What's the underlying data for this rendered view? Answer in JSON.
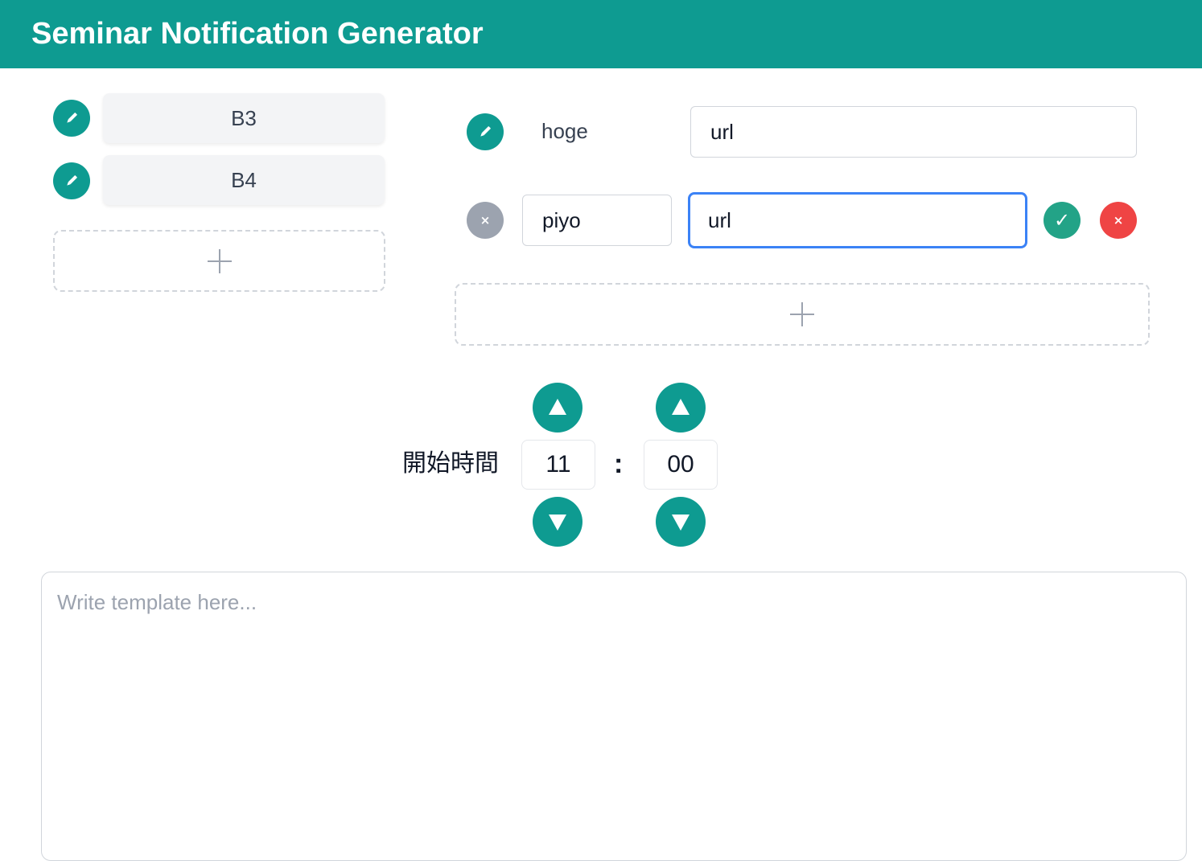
{
  "app": {
    "title": "Seminar Notification Generator",
    "accent_color": "#0e9b91"
  },
  "groups": {
    "items": [
      {
        "label": "B3",
        "icon": "pencil-icon"
      },
      {
        "label": "B4",
        "icon": "pencil-icon"
      }
    ],
    "add_icon": "plus-icon"
  },
  "links": {
    "rows": [
      {
        "name": "hoge",
        "url": "url",
        "mode": "view",
        "icon": "pencil-icon"
      },
      {
        "name": "piyo",
        "url": "url",
        "mode": "edit",
        "icon": "close-icon"
      }
    ],
    "confirm_icon": "check-icon",
    "cancel_icon": "close-icon",
    "confirm_glyph": "✓",
    "cancel_glyph": "×",
    "remove_glyph": "×",
    "add_icon": "plus-icon"
  },
  "start_time": {
    "label": "開始時間",
    "hour": "11",
    "minute": "00",
    "separator": ":"
  },
  "template": {
    "placeholder": "Write template here...",
    "value": ""
  }
}
